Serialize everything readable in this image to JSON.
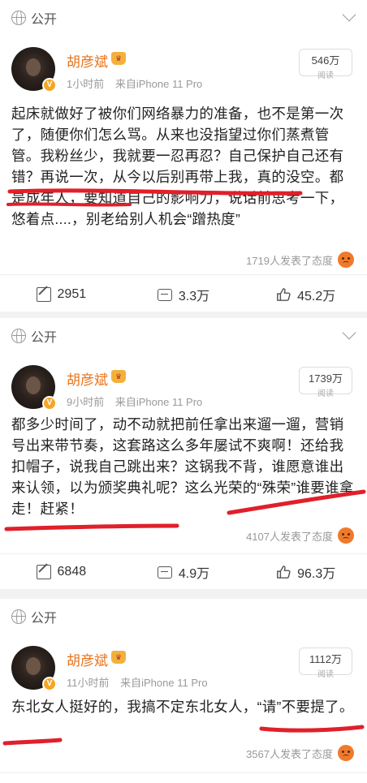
{
  "posts": [
    {
      "visibility": "公开",
      "author": "胡彦斌",
      "time": "1小时前",
      "source": "来自iPhone 11 Pro",
      "views": "546万",
      "views_label": "阅读",
      "text": "起床就做好了被你们网络暴力的准备，也不是第一次了，随便你们怎么骂。从来也没指望过你们蒸煮管管。我粉丝少，我就要一忍再忍？自己保护自己还有错？再说一次，从今以后别再带上我，真的没空。都是成年人，要知道自己的影响力，说话前思考一下，悠着点....，别老给别人机会“蹭热度”",
      "stance": "1719人发表了态度",
      "reposts": "2951",
      "comments": "3.3万",
      "likes": "45.2万"
    },
    {
      "visibility": "公开",
      "author": "胡彦斌",
      "time": "9小时前",
      "source": "来自iPhone 11 Pro",
      "views": "1739万",
      "views_label": "阅读",
      "text": "都多少时间了，动不动就把前任拿出来遛一遛，营销号出来带节奏，这套路这么多年屡试不爽啊！还给我扣帽子，说我自己跳出来？这锅我不背，谁愿意谁出来认领，以为颁奖典礼呢？这么光荣的“殊荣”谁要谁拿走！赶紧！",
      "stance": "4107人发表了态度",
      "reposts": "6848",
      "comments": "4.9万",
      "likes": "96.3万"
    },
    {
      "visibility": "公开",
      "author": "胡彦斌",
      "time": "11小时前",
      "source": "来自iPhone 11 Pro",
      "views": "1112万",
      "views_label": "阅读",
      "text": "东北女人挺好的，我搞不定东北女人，“请”不要提了。",
      "stance": "3567人发表了态度"
    }
  ],
  "colors": {
    "name": "#e8731a",
    "annotation": "#e0202a",
    "bg_gap": "#f2f2f2"
  }
}
